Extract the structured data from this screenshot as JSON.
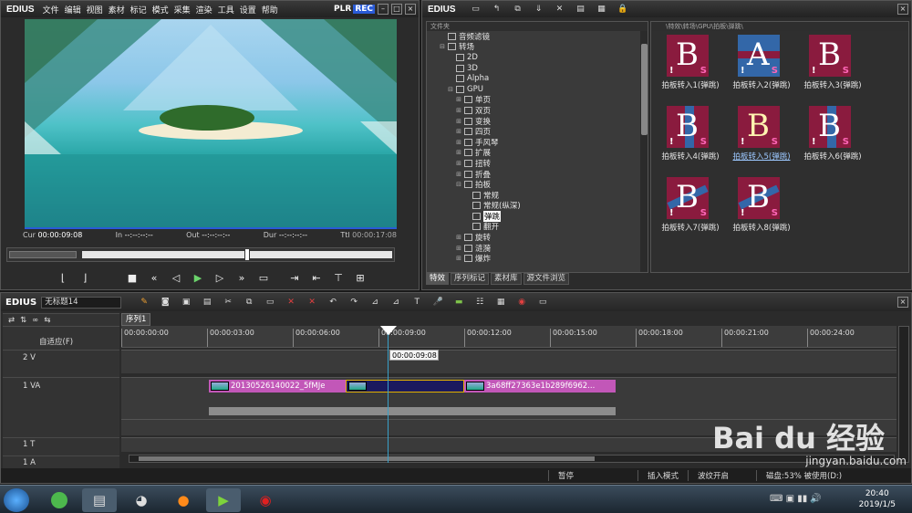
{
  "player": {
    "logo": "EDIUS",
    "menu": [
      "文件",
      "编辑",
      "视图",
      "素材",
      "标记",
      "模式",
      "采集",
      "渲染",
      "工具",
      "设置",
      "帮助"
    ],
    "plr": "PLR",
    "rec": "REC",
    "cur_label": "Cur",
    "cur": "00:00:09:08",
    "in_label": "In",
    "in": "--:--:--:--",
    "out_label": "Out",
    "out": "--:--:--:--",
    "dur_label": "Dur",
    "dur": "--:--:--:--",
    "ttl_label": "Ttl",
    "ttl": "00:00:17:08"
  },
  "effects": {
    "logo": "EDIUS",
    "tree_header": "文件夹",
    "grid_path": "\\特效\\转场\\GPU\\拍板\\弹跳\\",
    "tree": [
      {
        "label": "音频滤镜",
        "level": 1,
        "exp": ""
      },
      {
        "label": "转场",
        "level": 1,
        "exp": "⊟"
      },
      {
        "label": "2D",
        "level": 2,
        "exp": ""
      },
      {
        "label": "3D",
        "level": 2,
        "exp": ""
      },
      {
        "label": "Alpha",
        "level": 2,
        "exp": ""
      },
      {
        "label": "GPU",
        "level": 2,
        "exp": "⊟"
      },
      {
        "label": "单页",
        "level": 3,
        "exp": "⊞"
      },
      {
        "label": "双页",
        "level": 3,
        "exp": "⊞"
      },
      {
        "label": "变换",
        "level": 3,
        "exp": "⊞"
      },
      {
        "label": "四页",
        "level": 3,
        "exp": "⊞"
      },
      {
        "label": "手风琴",
        "level": 3,
        "exp": "⊞"
      },
      {
        "label": "扩展",
        "level": 3,
        "exp": "⊞"
      },
      {
        "label": "扭转",
        "level": 3,
        "exp": "⊞"
      },
      {
        "label": "折叠",
        "level": 3,
        "exp": "⊞"
      },
      {
        "label": "拍板",
        "level": 3,
        "exp": "⊟"
      },
      {
        "label": "常规",
        "level": 4,
        "exp": ""
      },
      {
        "label": "常规(纵深)",
        "level": 4,
        "exp": ""
      },
      {
        "label": "弹跳",
        "level": 4,
        "exp": "",
        "selected": true
      },
      {
        "label": "翻开",
        "level": 4,
        "exp": ""
      },
      {
        "label": "旋转",
        "level": 3,
        "exp": "⊞"
      },
      {
        "label": "涟漪",
        "level": 3,
        "exp": "⊞"
      },
      {
        "label": "爆炸",
        "level": 3,
        "exp": "⊞"
      }
    ],
    "thumbs": [
      {
        "label": "拍板转入1(弹跳)",
        "letter": "B",
        "variant": 1
      },
      {
        "label": "拍板转入2(弹跳)",
        "letter": "A",
        "variant": 2
      },
      {
        "label": "拍板转入3(弹跳)",
        "letter": "B",
        "variant": 3
      },
      {
        "label": "拍板转入4(弹跳)",
        "letter": "B",
        "variant": 4
      },
      {
        "label": "拍板转入5(弹跳)",
        "letter": "B",
        "variant": 5,
        "selected": true
      },
      {
        "label": "拍板转入6(弹跳)",
        "letter": "B",
        "variant": 6
      },
      {
        "label": "拍板转入7(弹跳)",
        "letter": "B",
        "variant": 7
      },
      {
        "label": "拍板转入8(弹跳)",
        "letter": "B",
        "variant": 8
      }
    ],
    "tabs": [
      "特效",
      "序列标记",
      "素材库",
      "源文件浏览"
    ],
    "active_tab": 0
  },
  "timeline": {
    "logo": "EDIUS",
    "project_name": "无标题14",
    "sequence_tab": "序列1",
    "mode_label": "自适应(F)",
    "ruler": [
      "00:00:00:00",
      "00:00:03:00",
      "00:00:06:00",
      "00:00:09:00",
      "00:00:12:00",
      "00:00:15:00",
      "00:00:18:00",
      "00:00:21:00",
      "00:00:24:00"
    ],
    "playhead_tc": "00:00:09:08",
    "tracks": [
      {
        "name": "2 V",
        "kind": "V"
      },
      {
        "name": "1 VA",
        "kind": "VA"
      },
      {
        "name": "1 T",
        "kind": "T"
      },
      {
        "name": "1 A",
        "kind": "A"
      }
    ],
    "clip1": "20130526140022_5fMJe",
    "clip2": "3a68ff27363e1b289f6962...",
    "status": [
      "暂停",
      "插入模式",
      "波纹开启",
      "磁盘:53% 被使用(D:)"
    ]
  },
  "taskbar": {
    "time": "20:40",
    "date": "2019/1/5"
  },
  "watermark": {
    "text": "Bai du 经验",
    "url": "jingyan.baidu.com"
  }
}
